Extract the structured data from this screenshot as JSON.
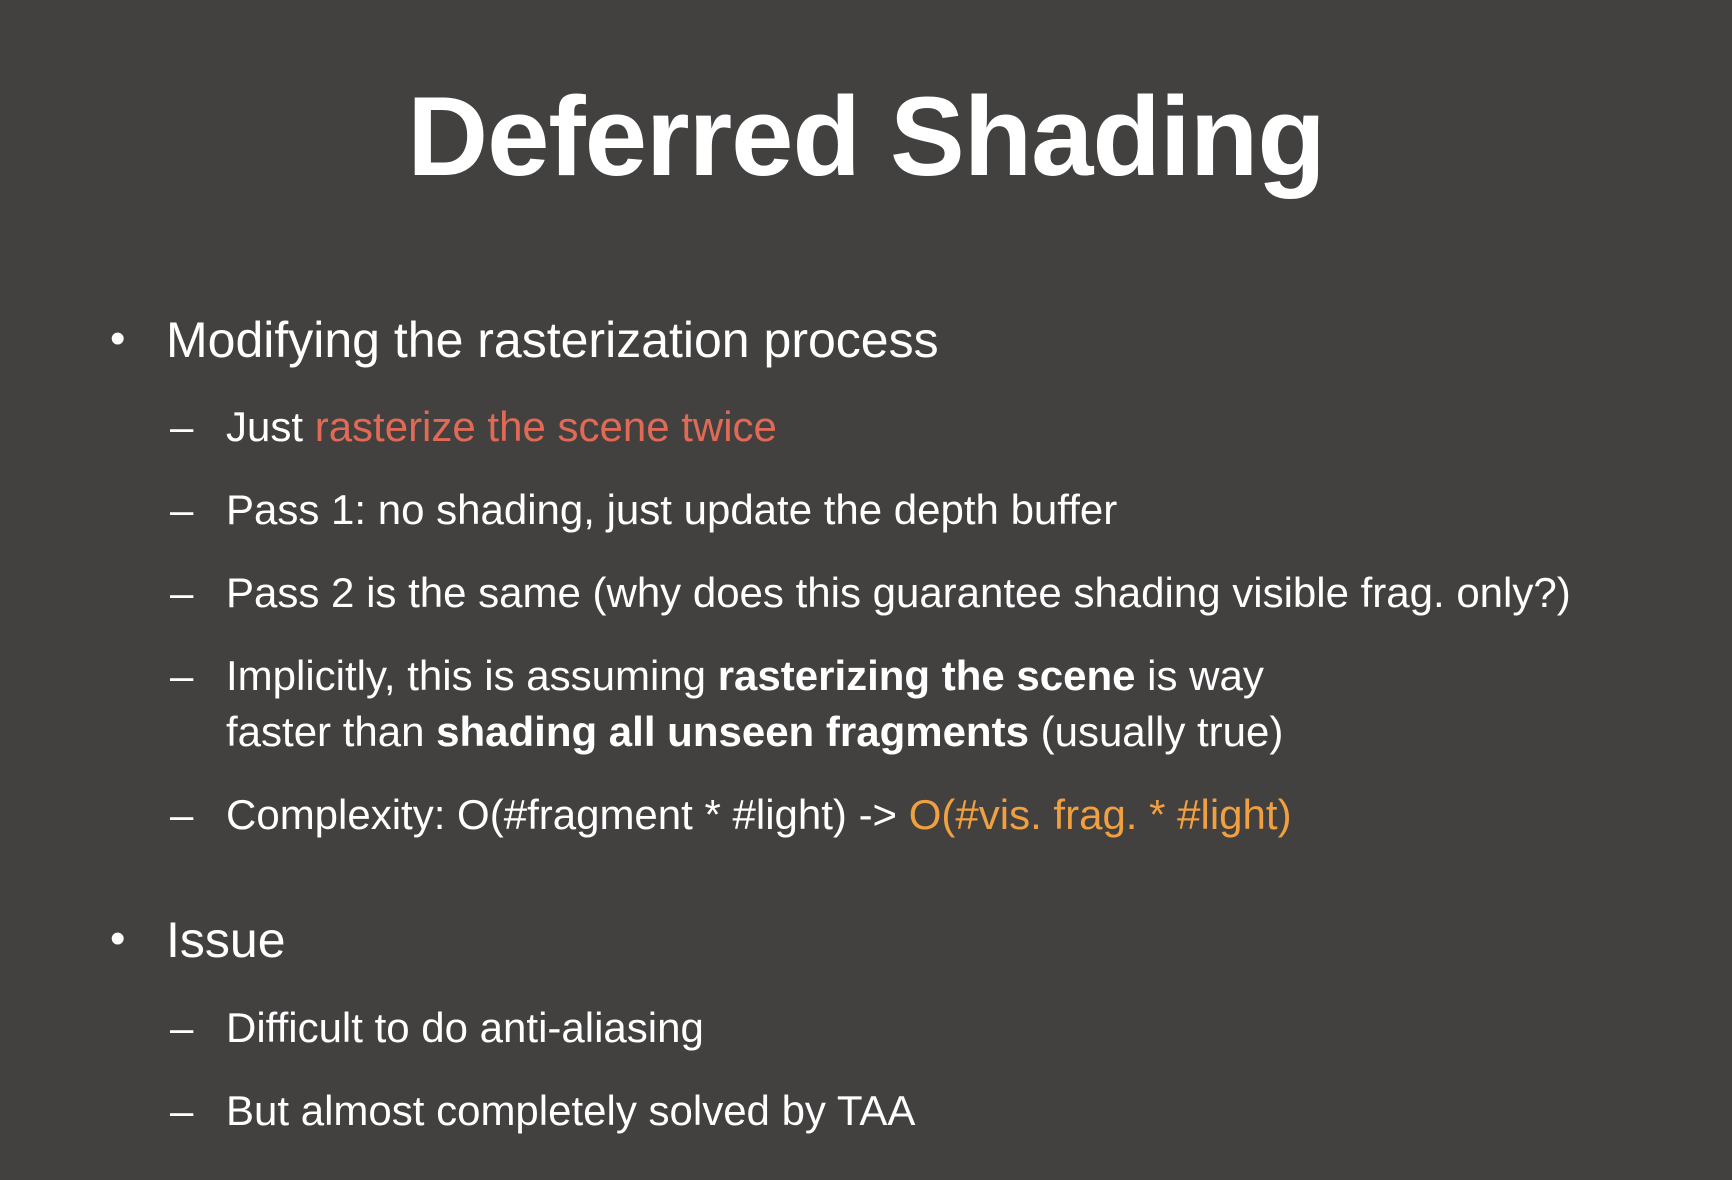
{
  "slide": {
    "title": "Deferred Shading",
    "colors": {
      "background": "#434140",
      "text": "#ffffff",
      "highlight_red": "#e06a55",
      "highlight_orange": "#f0a040"
    },
    "bullets": [
      {
        "marker": "•",
        "label": "Modifying the rasterization process",
        "items": [
          {
            "marker": "–",
            "prefix": "Just ",
            "highlight": "rasterize the scene twice"
          },
          {
            "marker": "–",
            "text": "Pass 1: no shading, just update the depth buffer"
          },
          {
            "marker": "–",
            "text": "Pass 2 is the same (why does this guarantee shading visible frag. only?)"
          },
          {
            "marker": "–",
            "line1_a": "Implicitly, this is assuming ",
            "line1_bold": "rasterizing the scene",
            "line1_b": " is way",
            "line2_a": "faster than ",
            "line2_bold": "shading all unseen fragments",
            "line2_b": " (usually true)"
          },
          {
            "marker": "–",
            "prefix": "Complexity: O(#fragment * #light) -> ",
            "highlight": "O(#vis. frag. * #light)"
          }
        ]
      },
      {
        "marker": "•",
        "label": "Issue",
        "items": [
          {
            "marker": "–",
            "text": "Difficult to do anti-aliasing"
          },
          {
            "marker": "–",
            "text": "But almost completely solved by TAA"
          }
        ]
      }
    ]
  }
}
